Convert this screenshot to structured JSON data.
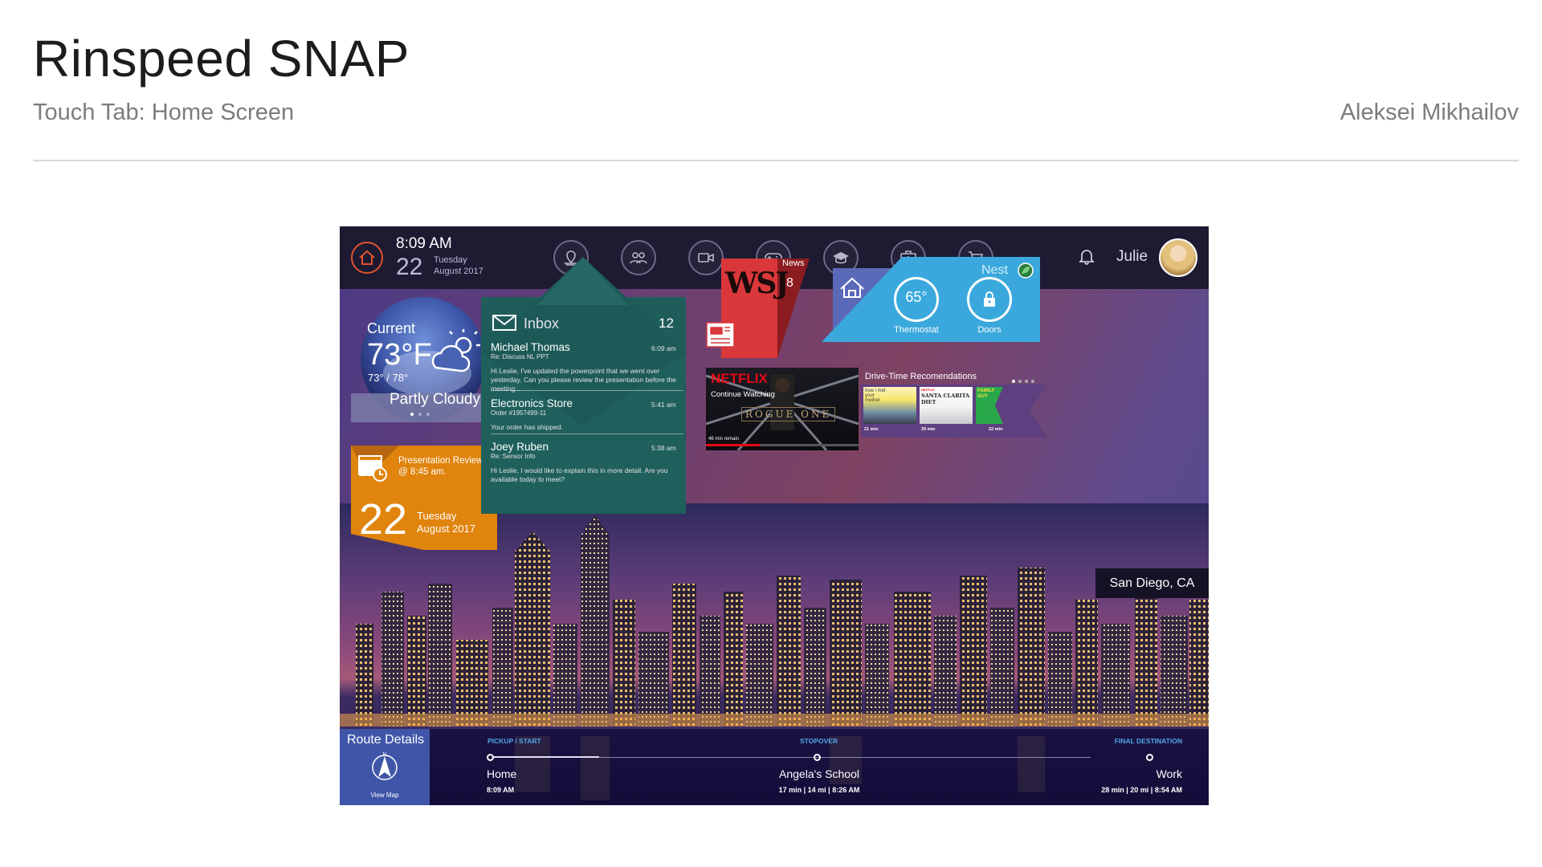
{
  "page": {
    "title": "Rinspeed SNAP",
    "subtitle": "Touch Tab: Home Screen",
    "author": "Aleksei Mikhailov"
  },
  "topbar": {
    "time": "8:09 AM",
    "day": "22",
    "weekday": "Tuesday",
    "month_year": "August 2017",
    "user": "Julie",
    "nav_icons": [
      "map-pin-icon",
      "people-icon",
      "video-icon",
      "gamepad-icon",
      "graduation-cap-icon",
      "first-aid-icon",
      "cart-icon"
    ]
  },
  "weather": {
    "label": "Current",
    "temp": "73°F",
    "range": "73° / 78°",
    "condition": "Partly Cloudy"
  },
  "calendar": {
    "event": "Presentation Review @ 8:45 am.",
    "day": "22",
    "weekday": "Tuesday",
    "month_year": "August 2017"
  },
  "inbox": {
    "title": "Inbox",
    "count": "12",
    "messages": [
      {
        "from": "Michael Thomas",
        "subject": "Re: Discuss NL PPT",
        "time": "6:09 am",
        "body": "Hi Leslie, I've updated the powerpoint that we went over yesterday. Can you please review the presentation before the meeting..."
      },
      {
        "from": "Electronics Store",
        "subject": "Order #1957499-11",
        "time": "5:41 am",
        "body": "Your order has shipped."
      },
      {
        "from": "Joey Ruben",
        "subject": "Re: Sensor Info",
        "time": "5:38 am",
        "body": "Hi Leslie, I would like to explain this in more detail. Are you available today to meet?"
      }
    ]
  },
  "news": {
    "label": "News",
    "count": "8",
    "logo": "WSJ"
  },
  "nest": {
    "title": "Nest",
    "thermostat_value": "65°",
    "thermostat_label": "Thermostat",
    "doors_label": "Doors"
  },
  "netflix": {
    "logo": "NETFLIX",
    "cta": "Continue Watching",
    "title": "ROGUE ONE",
    "remaining": "46 min remain",
    "progress": 0.35
  },
  "drive_time": {
    "title": "Drive-Time Recomendations",
    "items": [
      {
        "title": "how i met your mother",
        "duration": "21 min"
      },
      {
        "title": "SANTA CLARITA DIET",
        "duration": "29 min"
      },
      {
        "title": "FAMILY GUY",
        "duration": "22 min"
      }
    ]
  },
  "location": "San Diego, CA",
  "route": {
    "title": "Route Details",
    "view_map": "View Map",
    "stops": [
      {
        "heading": "PICKUP / START",
        "name": "Home",
        "meta": "8:09 AM"
      },
      {
        "heading": "STOPOVER",
        "name": "Angela's School",
        "meta": "17 min  |  14 mi  |  8:26 AM"
      },
      {
        "heading": "FINAL DESTINATION",
        "name": "Work",
        "meta": "28 min  |  20 mi  |  8:54 AM"
      }
    ]
  },
  "colors": {
    "accent_home": "#e0532e",
    "inbox_green": "#1f5d5a",
    "calendar_orange": "#e0840d",
    "news_red": "#d9373a",
    "nest_blue": "#3aa8dc",
    "route_blue": "#3f56a8",
    "netflix_red": "#e50914"
  }
}
